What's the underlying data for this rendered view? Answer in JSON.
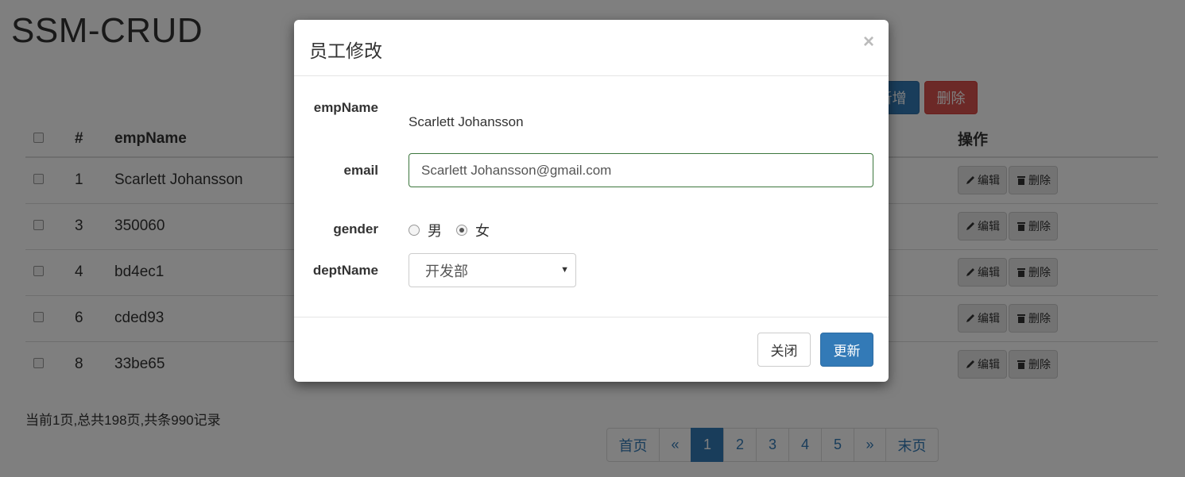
{
  "page": {
    "title": "SSM-CRUD"
  },
  "toolbar": {
    "add_label": "新增",
    "delete_label": "删除"
  },
  "table": {
    "headers": {
      "id": "#",
      "name": "empName",
      "ops": "操作"
    },
    "rows": [
      {
        "id": "1",
        "name": "Scarlett Johansson"
      },
      {
        "id": "3",
        "name": "350060"
      },
      {
        "id": "4",
        "name": "bd4ec1"
      },
      {
        "id": "6",
        "name": "cded93"
      },
      {
        "id": "8",
        "name": "33be65"
      }
    ],
    "edit_label": "编辑",
    "delete_label": "删除"
  },
  "page_info": "当前1页,总共198页,共条990记录",
  "pagination": {
    "first": "首页",
    "prev": "«",
    "pages": [
      "1",
      "2",
      "3",
      "4",
      "5"
    ],
    "active_page": "1",
    "next": "»",
    "last": "末页"
  },
  "modal": {
    "title": "员工修改",
    "close_symbol": "×",
    "labels": {
      "name": "empName",
      "email": "email",
      "gender": "gender",
      "dept": "deptName"
    },
    "emp_name_value": "Scarlett Johansson",
    "email_value": "Scarlett Johansson@gmail.com",
    "gender_options": [
      {
        "label": "男",
        "checked": false
      },
      {
        "label": "女",
        "checked": true
      }
    ],
    "dept_selected": "开发部",
    "close_button": "关闭",
    "update_button": "更新"
  },
  "colors": {
    "primary": "#337ab7",
    "danger": "#d9534f",
    "success_border": "#3c763d"
  }
}
